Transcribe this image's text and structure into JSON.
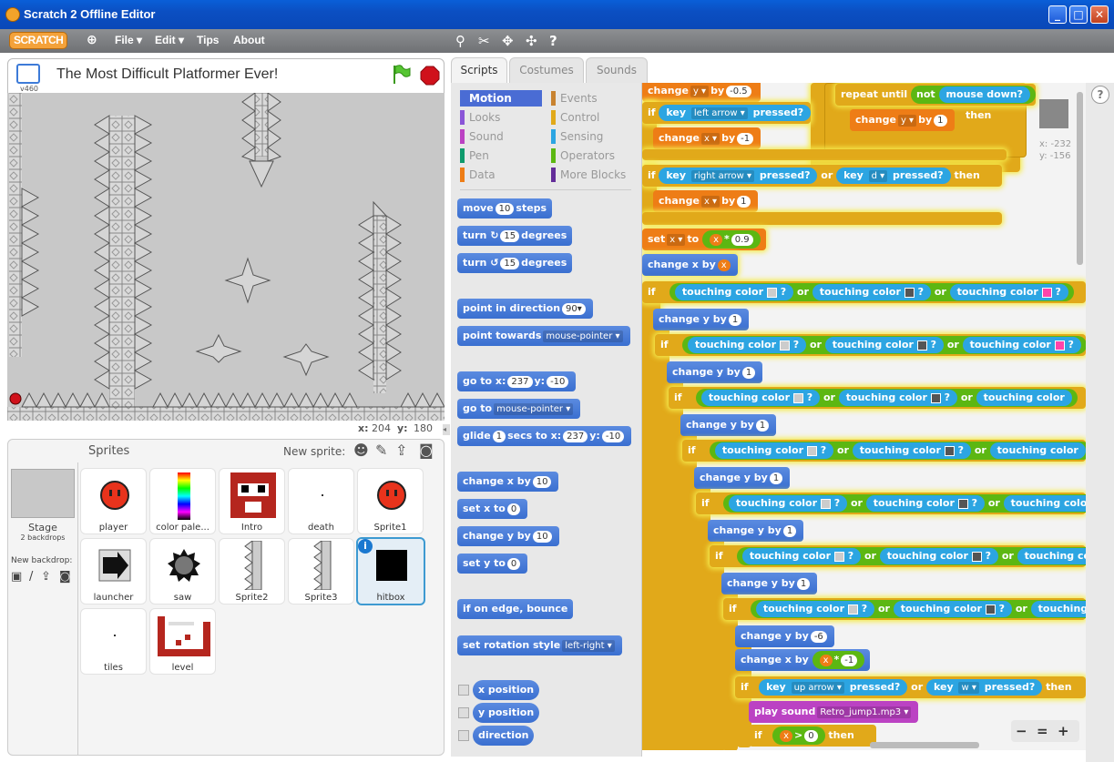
{
  "window": {
    "title": "Scratch 2 Offline Editor",
    "buttons": {
      "minimize": "_",
      "maximize": "□",
      "close": "✕"
    }
  },
  "menubar": {
    "logo": "SCRATCH",
    "items": [
      "File ▾",
      "Edit ▾",
      "Tips",
      "About"
    ]
  },
  "stage": {
    "version": "v460",
    "title": "The Most Difficult Platformer Ever!",
    "mouse_x_label": "x:",
    "mouse_x": "204",
    "mouse_y_label": "y:",
    "mouse_y": "180"
  },
  "sprites_panel": {
    "title": "Sprites",
    "new_sprite_label": "New sprite:",
    "stage_label": "Stage",
    "backdrops": "2 backdrops",
    "new_backdrop_label": "New backdrop:",
    "sprites": [
      {
        "name": "player"
      },
      {
        "name": "color pale..."
      },
      {
        "name": "Intro"
      },
      {
        "name": "death"
      },
      {
        "name": "Sprite1"
      },
      {
        "name": "launcher"
      },
      {
        "name": "saw"
      },
      {
        "name": "Sprite2"
      },
      {
        "name": "Sprite3"
      },
      {
        "name": "hitbox"
      },
      {
        "name": "tiles"
      },
      {
        "name": "level"
      }
    ]
  },
  "tabs": [
    "Scripts",
    "Costumes",
    "Sounds"
  ],
  "categories": {
    "left": [
      {
        "label": "Motion",
        "color": "#4a6cd4"
      },
      {
        "label": "Looks",
        "color": "#8a55d7"
      },
      {
        "label": "Sound",
        "color": "#bb42c3"
      },
      {
        "label": "Pen",
        "color": "#0e9a6c"
      },
      {
        "label": "Data",
        "color": "#ee7d16"
      }
    ],
    "right": [
      {
        "label": "Events",
        "color": "#c88330"
      },
      {
        "label": "Control",
        "color": "#e1a91a"
      },
      {
        "label": "Sensing",
        "color": "#2ca5e2"
      },
      {
        "label": "Operators",
        "color": "#5cb712"
      },
      {
        "label": "More Blocks",
        "color": "#632d99"
      }
    ]
  },
  "palette": {
    "move": {
      "a": "move",
      "v": "10",
      "b": "steps"
    },
    "turn_cw": {
      "a": "turn",
      "v": "15",
      "b": "degrees"
    },
    "turn_ccw": {
      "a": "turn",
      "v": "15",
      "b": "degrees"
    },
    "point_dir": {
      "a": "point in direction",
      "v": "90▾"
    },
    "point_towards": {
      "a": "point towards",
      "v": "mouse-pointer ▾"
    },
    "goto_xy": {
      "a": "go to x:",
      "x": "237",
      "b": "y:",
      "y": "-10"
    },
    "goto": {
      "a": "go to",
      "v": "mouse-pointer ▾"
    },
    "glide": {
      "a": "glide",
      "s": "1",
      "b": "secs to x:",
      "x": "237",
      "c": "y:",
      "y": "-10"
    },
    "change_x": {
      "a": "change x by",
      "v": "10"
    },
    "set_x": {
      "a": "set x to",
      "v": "0"
    },
    "change_y": {
      "a": "change y by",
      "v": "10"
    },
    "set_y": {
      "a": "set y to",
      "v": "0"
    },
    "bounce": "if on edge, bounce",
    "rotation": {
      "a": "set rotation style",
      "v": "left-right ▾"
    },
    "reporters": [
      "x position",
      "y position",
      "direction"
    ]
  },
  "script": {
    "top_change": {
      "a": "change",
      "v": "y ▾",
      "b": "by",
      "n": "-0.5"
    },
    "if1": {
      "a": "if",
      "key": "key",
      "k": "left arrow ▾",
      "pressed": "pressed?"
    },
    "change_x_m1": {
      "a": "change",
      "v": "x ▾",
      "b": "by",
      "n": "-1"
    },
    "if2": {
      "a": "if",
      "key": "key",
      "k": "right arrow ▾",
      "pressed": "pressed?",
      "or": "or",
      "key2": "key",
      "k2": "d ▾",
      "pressed2": "pressed?",
      "then": "then"
    },
    "change_x_1": {
      "a": "change",
      "v": "x ▾",
      "b": "by",
      "n": "1"
    },
    "set_x": {
      "a": "set",
      "v": "x ▾",
      "b": "to",
      "r": "x",
      "op": "*",
      "n": "0.9"
    },
    "change_x_by_x": {
      "a": "change x by",
      "r": "x"
    },
    "repeat": {
      "a": "repeat until",
      "not": "not",
      "md": "mouse down?"
    },
    "change_y_1": {
      "a": "change",
      "v": "y ▾",
      "b": "by",
      "n": "1",
      "then": "then"
    },
    "sprite_coords": {
      "x": "x: -232",
      "y": "y: -156"
    },
    "touching": "touching color",
    "q": "?",
    "or": "or",
    "if": "if",
    "change_y_by": "change y by",
    "one": "1",
    "change_y_m6": {
      "a": "change y by",
      "n": "-6"
    },
    "change_x_xm1": {
      "a": "change x by",
      "r": "x",
      "op": "*",
      "n": "-1"
    },
    "if_up": {
      "a": "if",
      "key": "key",
      "k": "up arrow ▾",
      "pressed": "pressed?",
      "or": "or",
      "key2": "key",
      "k2": "w ▾",
      "pressed2": "pressed?",
      "then": "then"
    },
    "play": {
      "a": "play sound",
      "v": "Retro_jump1.mp3 ▾"
    },
    "if_x": {
      "a": "if",
      "r": "x",
      "op": ">",
      "n": "0",
      "then": "then"
    }
  },
  "zoom": {
    "out": "−",
    "reset": "=",
    "in": "+"
  },
  "help": "?"
}
